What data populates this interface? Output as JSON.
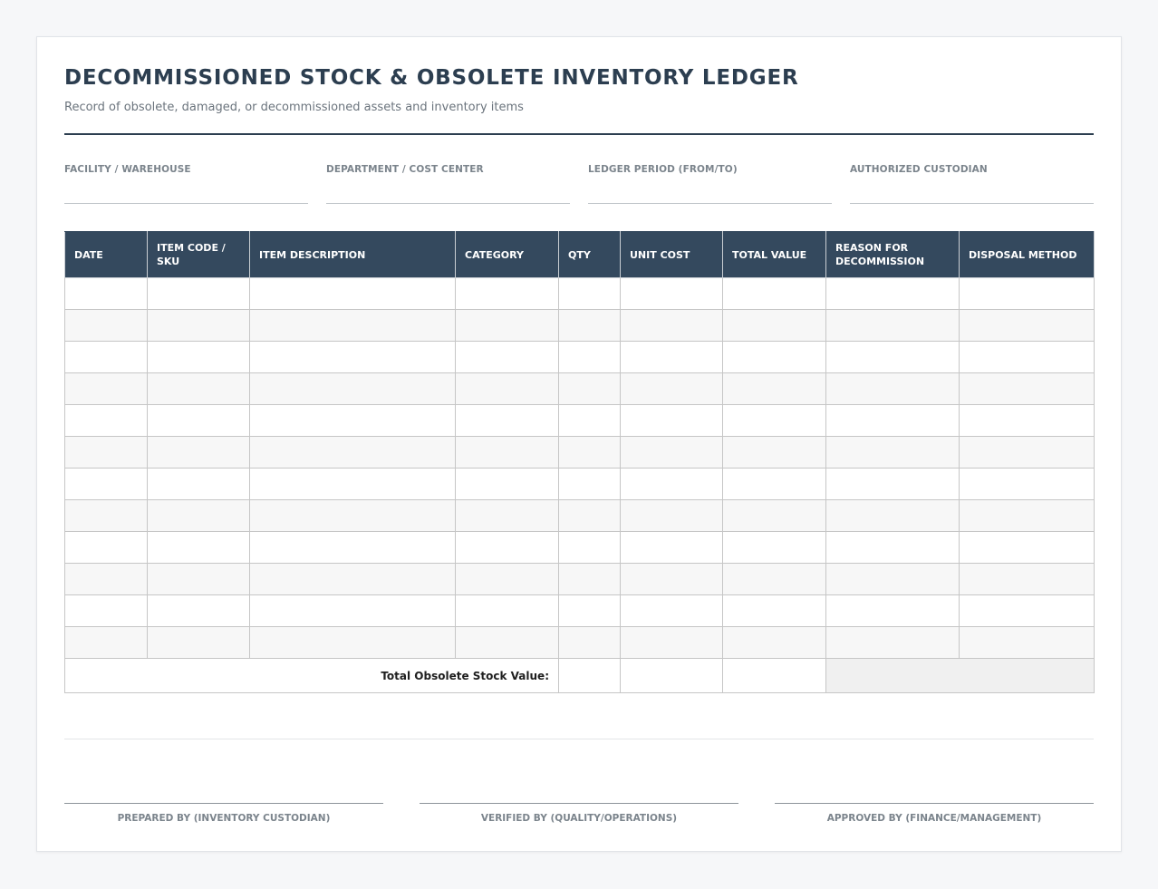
{
  "header": {
    "title": "DECOMMISSIONED STOCK & OBSOLETE INVENTORY LEDGER",
    "subtitle": "Record of obsolete, damaged, or decommissioned assets and inventory items"
  },
  "meta_fields": [
    {
      "label": "FACILITY / WAREHOUSE",
      "value": ""
    },
    {
      "label": "DEPARTMENT / COST CENTER",
      "value": ""
    },
    {
      "label": "LEDGER PERIOD (FROM/TO)",
      "value": ""
    },
    {
      "label": "AUTHORIZED CUSTODIAN",
      "value": ""
    }
  ],
  "table": {
    "columns": [
      "DATE",
      "ITEM CODE / SKU",
      "ITEM DESCRIPTION",
      "CATEGORY",
      "QTY",
      "UNIT COST",
      "TOTAL VALUE",
      "REASON FOR DECOMMISSION",
      "DISPOSAL METHOD"
    ],
    "rows": [
      [
        "",
        "",
        "",
        "",
        "",
        "",
        "",
        "",
        ""
      ],
      [
        "",
        "",
        "",
        "",
        "",
        "",
        "",
        "",
        ""
      ],
      [
        "",
        "",
        "",
        "",
        "",
        "",
        "",
        "",
        ""
      ],
      [
        "",
        "",
        "",
        "",
        "",
        "",
        "",
        "",
        ""
      ],
      [
        "",
        "",
        "",
        "",
        "",
        "",
        "",
        "",
        ""
      ],
      [
        "",
        "",
        "",
        "",
        "",
        "",
        "",
        "",
        ""
      ],
      [
        "",
        "",
        "",
        "",
        "",
        "",
        "",
        "",
        ""
      ],
      [
        "",
        "",
        "",
        "",
        "",
        "",
        "",
        "",
        ""
      ],
      [
        "",
        "",
        "",
        "",
        "",
        "",
        "",
        "",
        ""
      ],
      [
        "",
        "",
        "",
        "",
        "",
        "",
        "",
        "",
        ""
      ],
      [
        "",
        "",
        "",
        "",
        "",
        "",
        "",
        "",
        ""
      ],
      [
        "",
        "",
        "",
        "",
        "",
        "",
        "",
        "",
        ""
      ]
    ],
    "total_label": "Total Obsolete Stock Value:",
    "total_qty": "",
    "total_unit_cost": "",
    "total_value": ""
  },
  "signatures": [
    {
      "label": "PREPARED BY (INVENTORY CUSTODIAN)"
    },
    {
      "label": "VERIFIED BY (QUALITY/OPERATIONS)"
    },
    {
      "label": "APPROVED BY (FINANCE/MANAGEMENT)"
    }
  ],
  "colors": {
    "header_fill": "#34495e",
    "title_text": "#2c3e50",
    "row_alt": "#f7f7f7"
  }
}
